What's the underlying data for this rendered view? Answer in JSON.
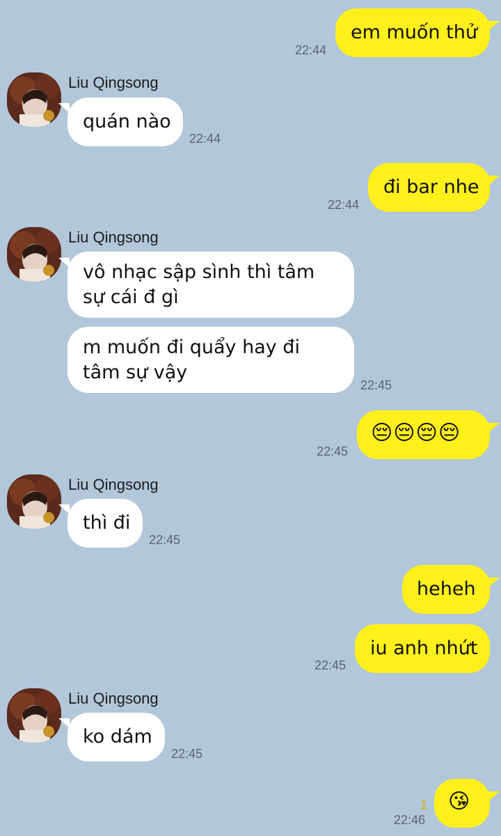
{
  "contact": {
    "name": "Liu Qingsong",
    "avatar_icon": "profile-photo"
  },
  "colors": {
    "background": "#b2c7d9",
    "incoming": "#ffffff",
    "outgoing": "#fef01b"
  },
  "messages": [
    {
      "dir": "out",
      "text": "em muốn thử",
      "time": "22:44"
    },
    {
      "dir": "in",
      "sender": "Liu Qingsong",
      "text": "quán nào",
      "time": "22:44"
    },
    {
      "dir": "out",
      "text": "đi bar nhe",
      "time": "22:44"
    },
    {
      "dir": "in",
      "sender": "Liu Qingsong",
      "text": "vô nhạc sập sình thì tâm sự cái đ gì"
    },
    {
      "dir": "in",
      "text": "m muốn đi quẩy hay đi tâm sự vậy",
      "time": "22:45"
    },
    {
      "dir": "out",
      "text": "😔😔😔😔",
      "time": "22:45"
    },
    {
      "dir": "in",
      "sender": "Liu Qingsong",
      "text": "thì đi",
      "time": "22:45"
    },
    {
      "dir": "out",
      "text": "heheh"
    },
    {
      "dir": "out",
      "text": "iu anh nhứt",
      "time": "22:45"
    },
    {
      "dir": "in",
      "sender": "Liu Qingsong",
      "text": "ko dám",
      "time": "22:45"
    },
    {
      "dir": "out",
      "text": "😘",
      "time": "22:46",
      "unread": "1"
    }
  ]
}
